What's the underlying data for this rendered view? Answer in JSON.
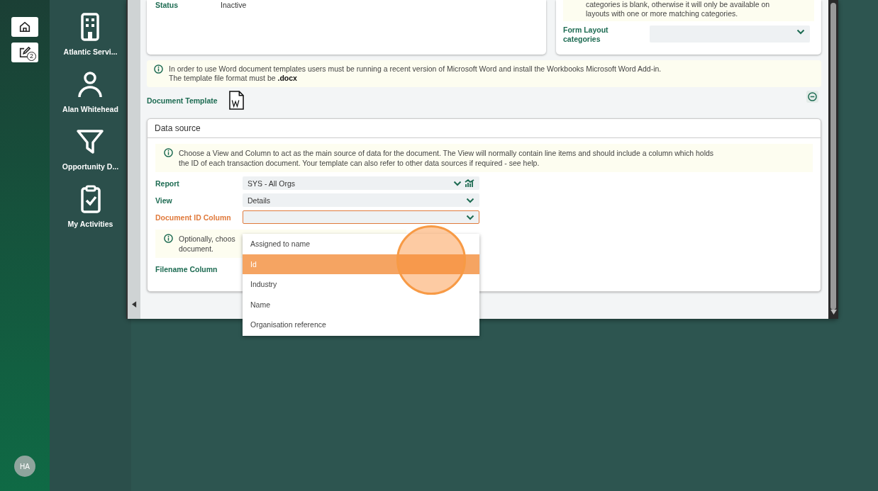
{
  "rail": {
    "edit_badge": "2",
    "avatar": "HA"
  },
  "nav": [
    {
      "label": "Atlantic Servi...",
      "kind": "building"
    },
    {
      "label": "Alan Whitehead",
      "kind": "person"
    },
    {
      "label": "Opportunity D...",
      "kind": "funnel"
    },
    {
      "label": "My Activities",
      "kind": "clipboard"
    }
  ],
  "details_card": {
    "fields": [
      {
        "label": "Status",
        "value": "Inactive"
      }
    ]
  },
  "categories_card": {
    "note_lines": [
      "categories is blank, otherwise it will only be available on",
      "layouts with one or more matching categories."
    ],
    "field_label": "Form Layout categories"
  },
  "word_notice": {
    "lines": [
      "In order to use Word document templates users must be running a recent version of Microsoft Word and install the Workbooks Microsoft Word Add-in.",
      "The template file format must be **.docx**"
    ]
  },
  "document_template": {
    "label": "Document Template"
  },
  "data_source": {
    "title": "Data source",
    "notice": [
      "Choose a View and Column to act as the main source of data for the document. The View will normally contain line items and should include a column which holds",
      "the ID of each transaction document. Your template can also refer to other data sources if required - see help."
    ],
    "fields": [
      {
        "label": "Report",
        "value": "SYS - All Orgs",
        "kind": "report",
        "active": false
      },
      {
        "label": "View",
        "value": "Details",
        "kind": "select",
        "active": false
      },
      {
        "label": "Document ID Column",
        "kind": "select",
        "active": true
      }
    ],
    "optional_notice": [
      "Optionally, choos",
      "document."
    ],
    "filename_label": "Filename Column"
  },
  "dropdown": {
    "options": [
      {
        "label": "Assigned to name",
        "selected": false
      },
      {
        "label": "Id",
        "selected": true
      },
      {
        "label": "Industry",
        "selected": false
      },
      {
        "label": "Name",
        "selected": false
      },
      {
        "label": "Organisation reference",
        "selected": false
      }
    ]
  }
}
